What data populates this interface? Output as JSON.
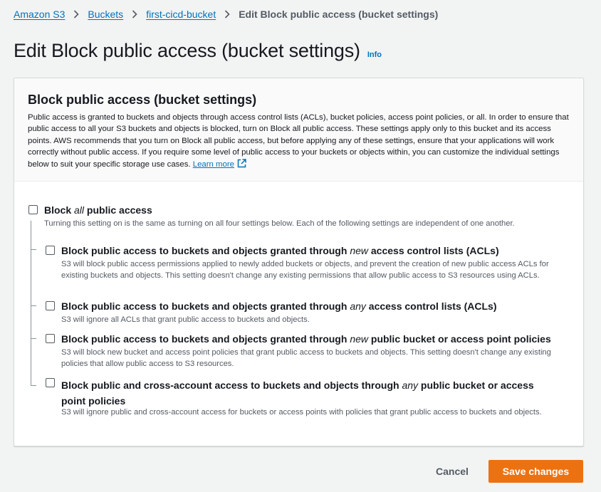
{
  "breadcrumbs": {
    "items": [
      "Amazon S3",
      "Buckets",
      "first-cicd-bucket"
    ],
    "current": "Edit Block public access (bucket settings)"
  },
  "page": {
    "title": "Edit Block public access (bucket settings)",
    "info_link": "Info"
  },
  "panel": {
    "title": "Block public access (bucket settings)",
    "description": "Public access is granted to buckets and objects through access control lists (ACLs), bucket policies, access point policies, or all. In order to ensure that public access to all your S3 buckets and objects is blocked, turn on Block all public access. These settings apply only to this bucket and its access points. AWS recommends that you turn on Block all public access, but before applying any of these settings, ensure that your applications will work correctly without public access. If you require some level of public access to your buckets or objects within, you can customize the individual settings below to suit your specific storage use cases.",
    "learn_more": "Learn more"
  },
  "block_all": {
    "label_pre": "Block ",
    "label_em": "all",
    "label_post": " public access",
    "description": "Turning this setting on is the same as turning on all four settings below. Each of the following settings are independent of one another.",
    "checked": false
  },
  "options": [
    {
      "label_pre": "Block public access to buckets and objects granted through ",
      "label_em": "new",
      "label_post": " access control lists (ACLs)",
      "description": "S3 will block public access permissions applied to newly added buckets or objects, and prevent the creation of new public access ACLs for existing buckets and objects. This setting doesn't change any existing permissions that allow public access to S3 resources using ACLs.",
      "checked": false
    },
    {
      "label_pre": "Block public access to buckets and objects granted through ",
      "label_em": "any",
      "label_post": " access control lists (ACLs)",
      "description": "S3 will ignore all ACLs that grant public access to buckets and objects.",
      "checked": false
    },
    {
      "label_pre": "Block public access to buckets and objects granted through ",
      "label_em": "new",
      "label_post": " public bucket or access point policies",
      "description": "S3 will block new bucket and access point policies that grant public access to buckets and objects. This setting doesn't change any existing policies that allow public access to S3 resources.",
      "checked": false
    },
    {
      "label_pre": "Block public and cross-account access to buckets and objects through ",
      "label_em": "any",
      "label_post": " public bucket or access point policies",
      "description": "S3 will ignore public and cross-account access for buckets or access points with policies that grant public access to buckets and objects.",
      "checked": false
    }
  ],
  "actions": {
    "cancel": "Cancel",
    "save": "Save changes"
  },
  "colors": {
    "link": "#0073bb",
    "primary_button": "#ec7211",
    "background": "#f2f3f3"
  }
}
